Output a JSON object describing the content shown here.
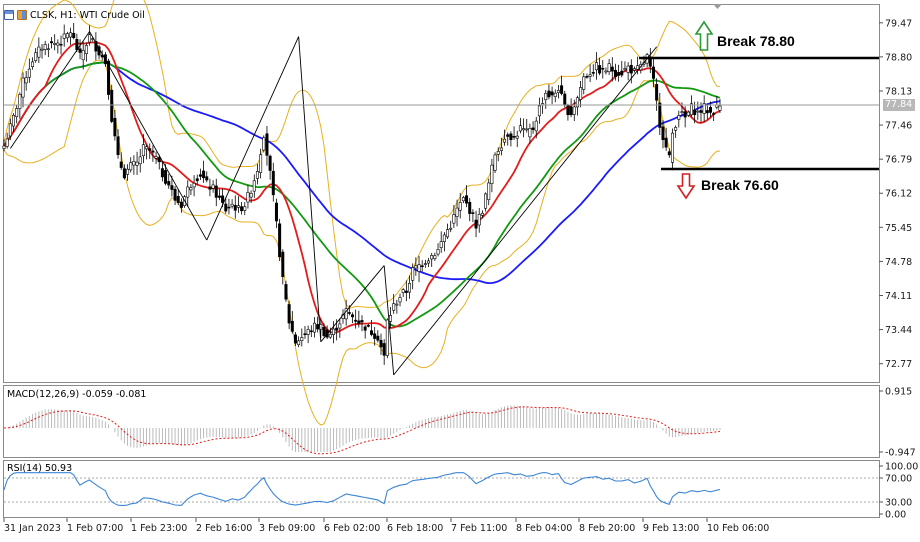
{
  "header": {
    "symbol": "CLSK,",
    "timeframe": "H1:",
    "instrument": "WTI Crude Oil"
  },
  "price_tag": "77.84",
  "annotations": {
    "break_up": "Break 78.80",
    "break_down": "Break 76.60"
  },
  "colors": {
    "candles": "#000000",
    "blue_ma": "#1a1aff",
    "green_ma": "#119911",
    "red_ma": "#e41b1b",
    "bollinger": "#e6b020",
    "macd_hist": "#b4b4b4",
    "macd_signal": "#e41b1b",
    "rsi": "#3d86d6",
    "arrow_up": "#27a745",
    "arrow_down": "#e02424"
  },
  "chart_data": [
    {
      "type": "candlestick",
      "panel": "price",
      "x_ticks": [
        "31 Jan 2023",
        "1 Feb 07:00",
        "1 Feb 23:00",
        "2 Feb 16:00",
        "3 Feb 09:00",
        "6 Feb 02:00",
        "6 Feb 18:00",
        "7 Feb 11:00",
        "8 Feb 04:00",
        "8 Feb 20:00",
        "9 Feb 13:00",
        "10 Feb 06:00"
      ],
      "y_ticks": [
        "79.47",
        "78.80",
        "78.13",
        "77.46",
        "76.79",
        "76.12",
        "75.45",
        "74.78",
        "74.11",
        "73.44",
        "72.77"
      ],
      "ylim": [
        72.41,
        79.82
      ],
      "current_price": 77.84,
      "resistance": 78.8,
      "support": 76.6,
      "close_path": [
        [
          0,
          77.05
        ],
        [
          3,
          77.6
        ],
        [
          6,
          78.3
        ],
        [
          9,
          78.75
        ],
        [
          12,
          79.0
        ],
        [
          15,
          79.05
        ],
        [
          18,
          79.1
        ],
        [
          21,
          79.3
        ],
        [
          24,
          78.8
        ],
        [
          27,
          79.2
        ],
        [
          30,
          78.9
        ],
        [
          32,
          78.7
        ],
        [
          34,
          77.6
        ],
        [
          36,
          76.8
        ],
        [
          38,
          76.5
        ],
        [
          40,
          76.65
        ],
        [
          42,
          76.7
        ],
        [
          44,
          77.0
        ],
        [
          46,
          76.95
        ],
        [
          48,
          76.8
        ],
        [
          50,
          76.5
        ],
        [
          52,
          76.3
        ],
        [
          54,
          76.0
        ],
        [
          56,
          75.9
        ],
        [
          58,
          76.2
        ],
        [
          60,
          76.4
        ],
        [
          62,
          76.5
        ],
        [
          64,
          76.3
        ],
        [
          66,
          76.2
        ],
        [
          68,
          76.0
        ],
        [
          70,
          75.8
        ],
        [
          72,
          75.9
        ],
        [
          74,
          75.8
        ],
        [
          76,
          75.9
        ],
        [
          78,
          76.2
        ],
        [
          80,
          76.6
        ],
        [
          82,
          77.3
        ],
        [
          84,
          76.5
        ],
        [
          86,
          75.5
        ],
        [
          88,
          74.4
        ],
        [
          90,
          73.6
        ],
        [
          92,
          73.2
        ],
        [
          94,
          73.3
        ],
        [
          96,
          73.4
        ],
        [
          98,
          73.5
        ],
        [
          100,
          73.5
        ],
        [
          102,
          73.3
        ],
        [
          104,
          73.4
        ],
        [
          106,
          73.6
        ],
        [
          108,
          73.8
        ],
        [
          110,
          73.7
        ],
        [
          112,
          73.6
        ],
        [
          114,
          73.5
        ],
        [
          116,
          73.4
        ],
        [
          118,
          73.3
        ],
        [
          120,
          72.9
        ],
        [
          121,
          73.6
        ],
        [
          123,
          73.9
        ],
        [
          125,
          74.1
        ],
        [
          127,
          74.2
        ],
        [
          129,
          74.6
        ],
        [
          131,
          74.7
        ],
        [
          133,
          74.8
        ],
        [
          135,
          74.9
        ],
        [
          137,
          75.0
        ],
        [
          139,
          75.3
        ],
        [
          141,
          75.5
        ],
        [
          143,
          75.8
        ],
        [
          145,
          76.0
        ],
        [
          147,
          75.8
        ],
        [
          149,
          75.5
        ],
        [
          151,
          75.8
        ],
        [
          153,
          76.3
        ],
        [
          155,
          76.9
        ],
        [
          157,
          77.1
        ],
        [
          159,
          77.3
        ],
        [
          161,
          77.2
        ],
        [
          163,
          77.4
        ],
        [
          165,
          77.3
        ],
        [
          167,
          77.4
        ],
        [
          169,
          77.8
        ],
        [
          171,
          78.1
        ],
        [
          173,
          78.0
        ],
        [
          175,
          78.2
        ],
        [
          177,
          77.8
        ],
        [
          179,
          77.7
        ],
        [
          181,
          78.0
        ],
        [
          183,
          78.4
        ],
        [
          185,
          78.5
        ],
        [
          187,
          78.6
        ],
        [
          189,
          78.5
        ],
        [
          191,
          78.6
        ],
        [
          193,
          78.5
        ],
        [
          195,
          78.5
        ],
        [
          197,
          78.6
        ],
        [
          199,
          78.5
        ],
        [
          201,
          78.6
        ],
        [
          203,
          78.8
        ],
        [
          205,
          78.3
        ],
        [
          207,
          77.5
        ],
        [
          209,
          77.0
        ],
        [
          210,
          76.8
        ],
        [
          211,
          77.3
        ],
        [
          213,
          77.7
        ],
        [
          215,
          77.6
        ],
        [
          217,
          77.8
        ],
        [
          219,
          77.7
        ],
        [
          221,
          77.8
        ],
        [
          223,
          77.7
        ],
        [
          225,
          77.8
        ],
        [
          226,
          77.84
        ]
      ]
    },
    {
      "type": "histogram",
      "panel": "oscillator",
      "label": "MACD(12,26,9) -0.059 -0.081",
      "y_ticks": [
        "0.915",
        "-0.947"
      ],
      "ylim": [
        -0.947,
        0.915
      ]
    },
    {
      "type": "line",
      "panel": "oscillator",
      "label": "RSI(14) 50.93",
      "y_ticks": [
        "100.00",
        "70.00",
        "30.00",
        "0.00"
      ],
      "ylim": [
        0,
        100
      ],
      "levels": [
        30,
        70
      ]
    }
  ]
}
